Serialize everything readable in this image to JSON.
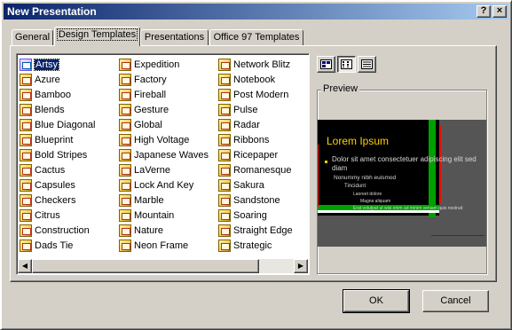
{
  "window": {
    "title": "New Presentation",
    "help_label": "?",
    "close_label": "×"
  },
  "tabs": [
    {
      "label": "General",
      "active": false
    },
    {
      "label": "Design Templates",
      "active": true
    },
    {
      "label": "Presentations",
      "active": false
    },
    {
      "label": "Office 97 Templates",
      "active": false
    }
  ],
  "templates": {
    "selected": "Artsy",
    "columns": [
      [
        "Artsy",
        "Azure",
        "Bamboo",
        "Blends",
        "Blue Diagonal",
        "Blueprint",
        "Bold Stripes",
        "Cactus",
        "Capsules",
        "Checkers",
        "Citrus",
        "Construction",
        "Dads Tie"
      ],
      [
        "Expedition",
        "Factory",
        "Fireball",
        "Gesture",
        "Global",
        "High Voltage",
        "Japanese Waves",
        "LaVerne",
        "Lock And Key",
        "Marble",
        "Mountain",
        "Nature",
        "Neon Frame"
      ],
      [
        "Network Blitz",
        "Notebook",
        "Post Modern",
        "Pulse",
        "Radar",
        "Ribbons",
        "Ricepaper",
        "Romanesque",
        "Sakura",
        "Sandstone",
        "Soaring",
        "Straight Edge",
        "Strategic"
      ]
    ],
    "icon": "template-file-icon"
  },
  "view_buttons": [
    {
      "name": "large-icons-view-icon",
      "pressed": false
    },
    {
      "name": "list-view-icon",
      "pressed": true
    },
    {
      "name": "details-view-icon",
      "pressed": false
    }
  ],
  "preview": {
    "label": "Preview",
    "slide_title": "Lorem Ipsum",
    "bullet1": "Dolor sit amet consectetuer adipiscing elit sed diam",
    "bullet2": "Nonummy nibh euismod",
    "bullet3": "Tincidunt",
    "bullet4": "Laoreet dolore",
    "bullet5": "Magna aliquam",
    "bullet6": "Erat volutpat ut wisi enim ad minim veniam quis nostrud",
    "colors": {
      "background": "#000000",
      "title": "#ffd000",
      "accent": "#00a000",
      "side_band": "#555555"
    }
  },
  "buttons": {
    "ok": "OK",
    "cancel": "Cancel"
  }
}
